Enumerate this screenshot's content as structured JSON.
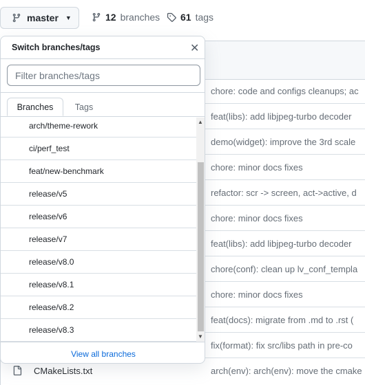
{
  "branch_selector": {
    "label": "master"
  },
  "stats": {
    "branches_count": "12",
    "branches_label": "branches",
    "tags_count": "61",
    "tags_label": "tags"
  },
  "dropdown": {
    "title": "Switch branches/tags",
    "filter_placeholder": "Filter branches/tags",
    "tabs": [
      "Branches",
      "Tags"
    ],
    "active_tab": "Branches",
    "items": [
      "arch/theme-rework",
      "ci/perf_test",
      "feat/new-benchmark",
      "release/v5",
      "release/v6",
      "release/v7",
      "release/v8.0",
      "release/v8.1",
      "release/v8.2",
      "release/v8.3"
    ],
    "view_all": "View all branches"
  },
  "commits": [
    "chore: code and configs cleanups; ac",
    "feat(libs): add libjpeg-turbo decoder",
    "demo(widget): improve the 3rd scale",
    "chore: minor docs fixes",
    "refactor: scr -> screen, act->active, d",
    "chore: minor docs fixes",
    "feat(libs): add libjpeg-turbo decoder",
    "chore(conf): clean up lv_conf_templa",
    "chore: minor docs fixes",
    "feat(docs): migrate from .md to .rst (",
    "fix(format): fix src/libs path in pre-co",
    "arch(env): arch(env): move the cmake"
  ],
  "file": {
    "name": "CMakeLists.txt"
  },
  "colors": {
    "link": "#0969da",
    "border": "#d0d7de",
    "muted": "#656d76"
  }
}
